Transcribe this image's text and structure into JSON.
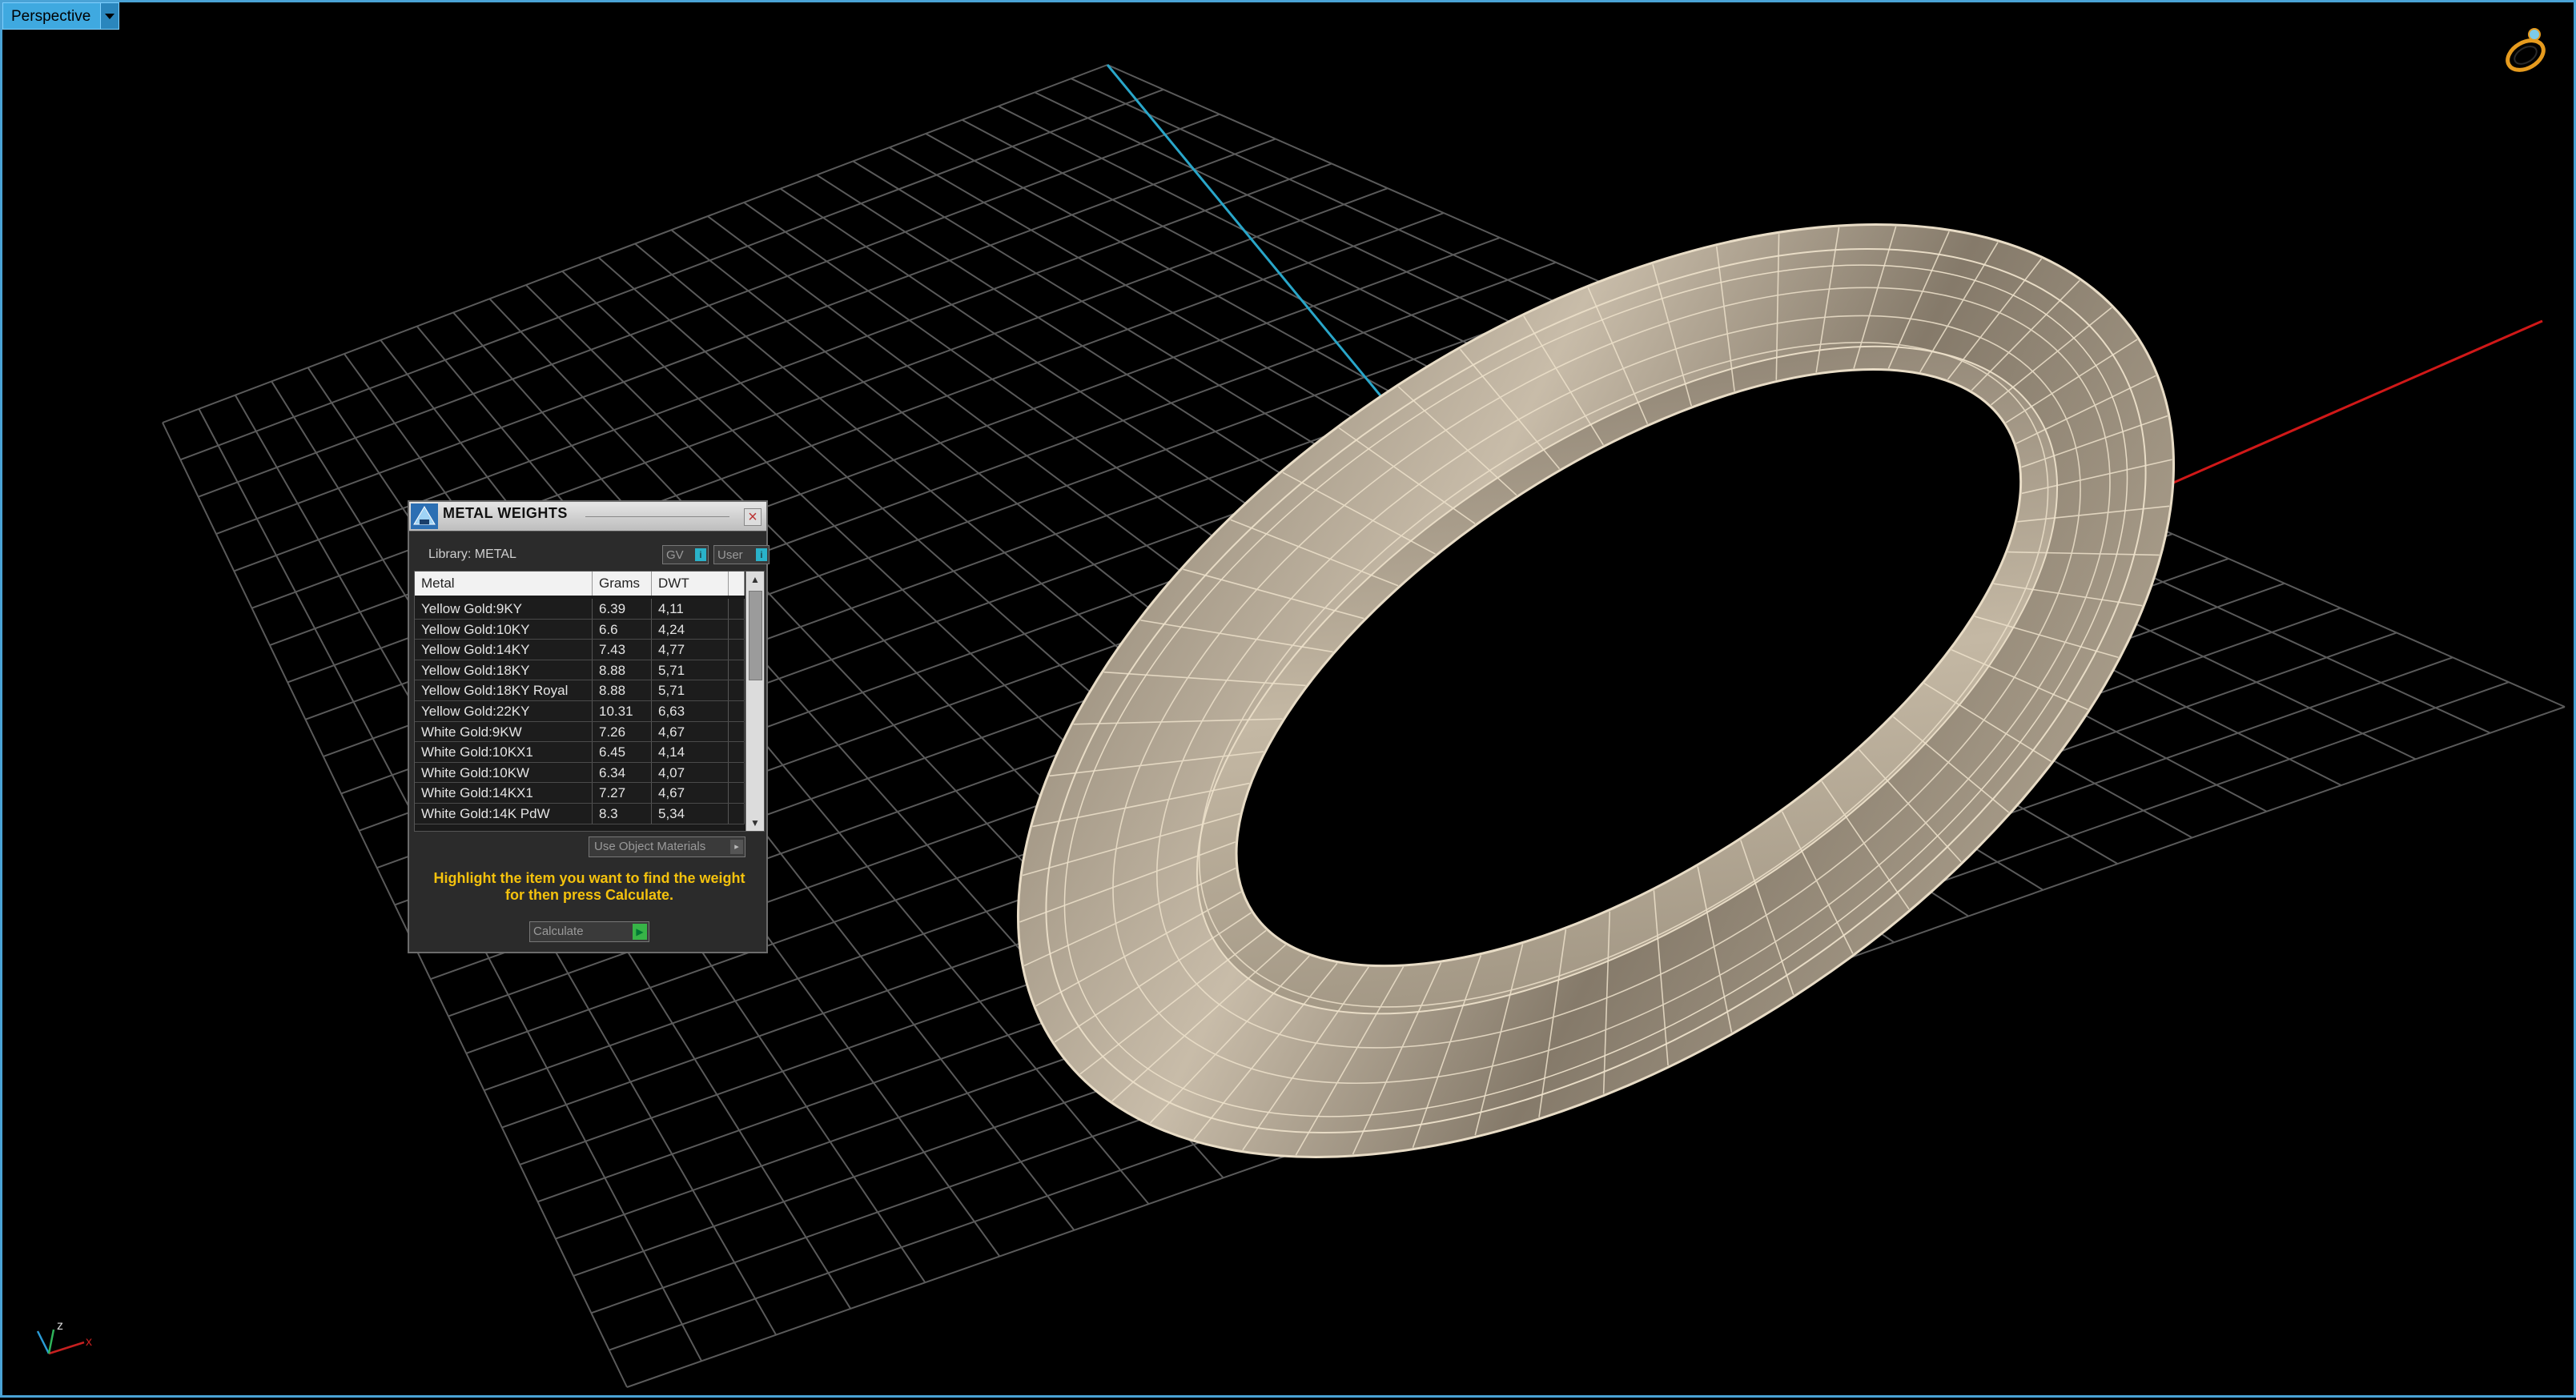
{
  "viewport": {
    "label": "Perspective",
    "colors": {
      "background": "#000000",
      "grid": "#5a5a5a",
      "x_axis": "#d01818",
      "y_axis": "#29a6c9",
      "ring": "#c9bba6"
    }
  },
  "panel": {
    "title": "METAL WEIGHTS",
    "library_label": "Library: METAL",
    "gv_button": "GV",
    "user_button": "User",
    "columns": [
      "Metal",
      "Grams",
      "DWT"
    ],
    "rows": [
      {
        "metal": "Yellow Gold:9KY",
        "grams": "6.39",
        "dwt": "4,11"
      },
      {
        "metal": "Yellow Gold:10KY",
        "grams": "6.6",
        "dwt": "4,24"
      },
      {
        "metal": "Yellow Gold:14KY",
        "grams": "7.43",
        "dwt": "4,77"
      },
      {
        "metal": "Yellow Gold:18KY",
        "grams": "8.88",
        "dwt": "5,71"
      },
      {
        "metal": "Yellow Gold:18KY Royal",
        "grams": "8.88",
        "dwt": "5,71"
      },
      {
        "metal": "Yellow Gold:22KY",
        "grams": "10.31",
        "dwt": "6,63"
      },
      {
        "metal": "White Gold:9KW",
        "grams": "7.26",
        "dwt": "4,67"
      },
      {
        "metal": "White Gold:10KX1",
        "grams": "6.45",
        "dwt": "4,14"
      },
      {
        "metal": "White Gold:10KW",
        "grams": "6.34",
        "dwt": "4,07"
      },
      {
        "metal": "White Gold:14KX1",
        "grams": "7.27",
        "dwt": "4,67"
      },
      {
        "metal": "White Gold:14K PdW",
        "grams": "8.3",
        "dwt": "5,34"
      }
    ],
    "use_object_materials": "Use Object Materials",
    "hint": "Highlight the item you want to find the weight for then press Calculate.",
    "calculate": "Calculate"
  },
  "icons": {
    "ring": "ring-icon",
    "axes": "axes-icon",
    "close": "close-icon",
    "logo": "metal-weights-logo-icon"
  },
  "axes_labels": {
    "x": "x",
    "z": "z"
  }
}
